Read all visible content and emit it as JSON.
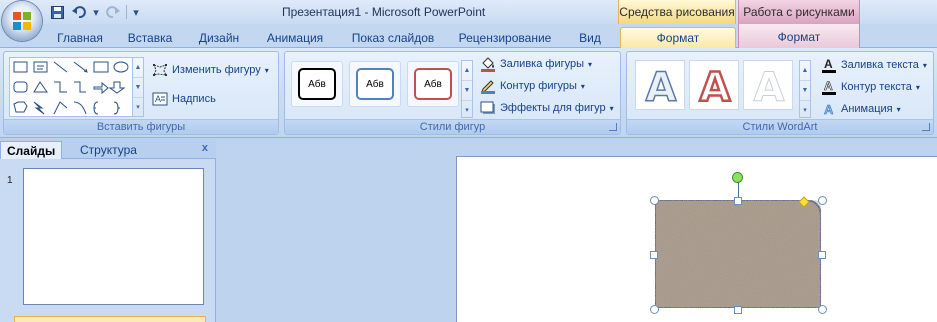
{
  "titlebar": {
    "title": "Презентация1 - Microsoft PowerPoint",
    "context_drawing": "Средства рисования",
    "context_picture": "Работа с рисунками",
    "qat": {
      "save_icon": "save-icon",
      "undo_icon": "undo-icon",
      "redo_icon": "redo-icon",
      "customize_icon": "customize-qat-icon"
    }
  },
  "tabs": [
    {
      "label": "Главная"
    },
    {
      "label": "Вставка"
    },
    {
      "label": "Дизайн"
    },
    {
      "label": "Анимация"
    },
    {
      "label": "Показ слайдов"
    },
    {
      "label": "Рецензирование"
    },
    {
      "label": "Вид"
    },
    {
      "label": "Формат"
    },
    {
      "label": "Формат"
    }
  ],
  "ribbon": {
    "insert_shapes": {
      "label": "Вставить фигуры",
      "edit_shape": "Изменить фигуру",
      "textbox": "Надпись"
    },
    "shape_styles": {
      "label": "Стили фигур",
      "sample_text": "Абв",
      "fill": "Заливка фигуры",
      "outline": "Контур фигуры",
      "effects": "Эффекты для фигур"
    },
    "wordart": {
      "label": "Стили WordArt",
      "sample_letter": "A",
      "text_fill": "Заливка текста",
      "text_outline": "Контур текста",
      "animation": "Анимация"
    }
  },
  "slide_pane": {
    "tab_slides": "Слайды",
    "tab_outline": "Структура",
    "close": "x",
    "slide_number": "1"
  },
  "colors": {
    "ribbon_bg": "#c8dbf2",
    "text": "#15428b",
    "context_drawing": "#f4d880",
    "context_picture": "#d8a3c0",
    "shape_fill": "#9c8b78"
  }
}
